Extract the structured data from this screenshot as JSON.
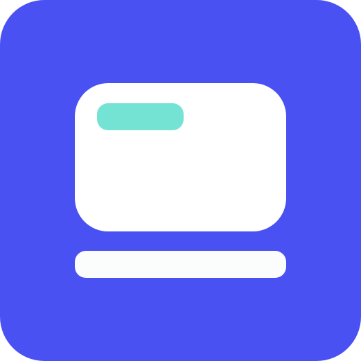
{
  "icon": {
    "name": "app-launcher-icon",
    "colors": {
      "background": "#4a51f2",
      "card": "#ffffff",
      "accent_pill": "#74e3d3",
      "bar": "#fbfdfd"
    }
  }
}
